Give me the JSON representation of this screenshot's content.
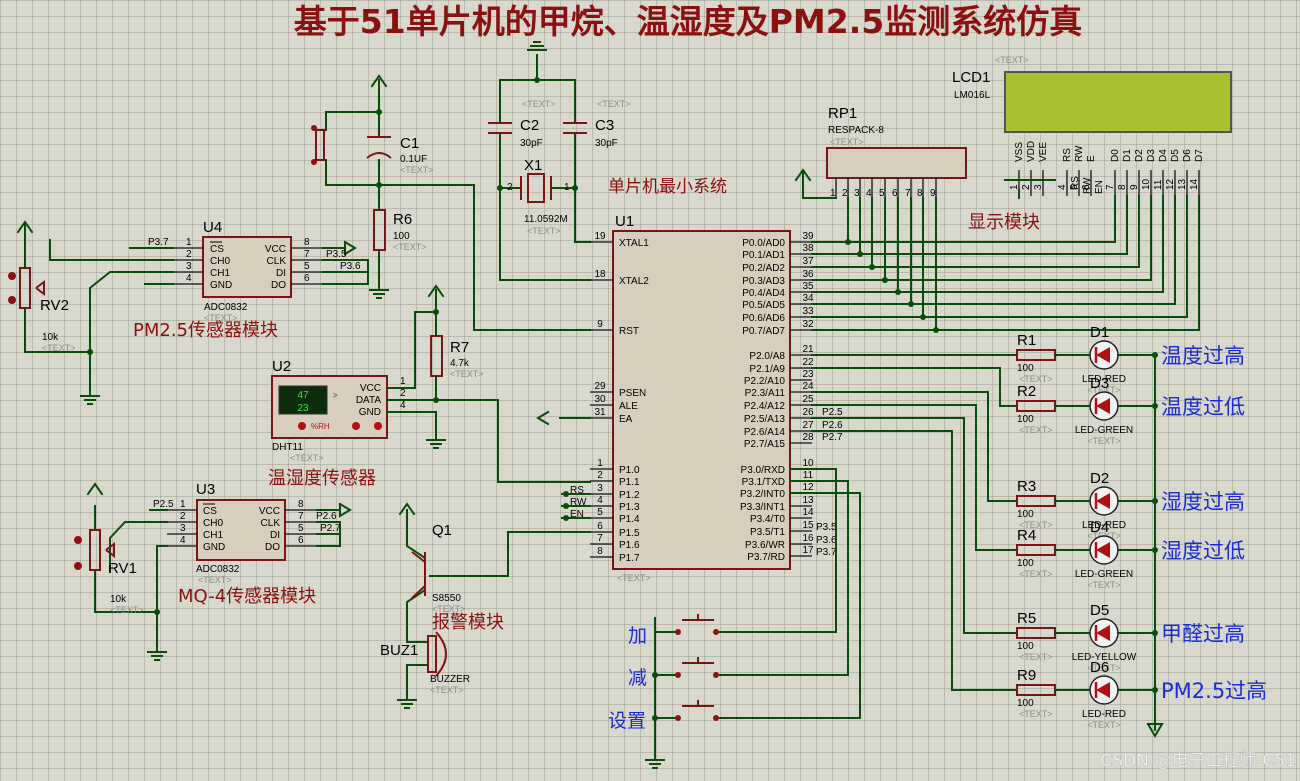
{
  "title": "基于51单片机的甲烷、温湿度及PM2.5监测系统仿真",
  "watermark": "CSDN @电子工程师-C51",
  "text_placeholder": "<TEXT>",
  "modules": {
    "pm25": "PM2.5传感器模块",
    "mq4": "MQ-4传感器模块",
    "dht": "温湿度传感器",
    "alarm": "报警模块",
    "mcu_min": "单片机最小系统",
    "display": "显示模块"
  },
  "components": {
    "C1": {
      "ref": "C1",
      "value": "0.1UF"
    },
    "C2": {
      "ref": "C2",
      "value": "30pF"
    },
    "C3": {
      "ref": "C3",
      "value": "30pF"
    },
    "X1": {
      "ref": "X1",
      "value": "11.0592M"
    },
    "R6": {
      "ref": "R6",
      "value": "100"
    },
    "R7": {
      "ref": "R7",
      "value": "4.7k"
    },
    "RV1": {
      "ref": "RV1",
      "value": "10k"
    },
    "RV2": {
      "ref": "RV2",
      "value": "10k"
    },
    "U1": {
      "ref": "U1"
    },
    "U2": {
      "ref": "U2",
      "value": "DHT11",
      "display_top": "47",
      "display_bottom": "23",
      "rh_label": "%RH"
    },
    "U3": {
      "ref": "U3",
      "value": "ADC0832"
    },
    "U4": {
      "ref": "U4",
      "value": "ADC0832"
    },
    "Q1": {
      "ref": "Q1",
      "value": "S8550"
    },
    "BUZ1": {
      "ref": "BUZ1",
      "value": "BUZZER"
    },
    "RP1": {
      "ref": "RP1",
      "value": "RESPACK-8"
    },
    "LCD1": {
      "ref": "LCD1",
      "value": "LM016L"
    }
  },
  "adc_pins": {
    "left": [
      "CS",
      "CH0",
      "CH1",
      "GND"
    ],
    "left_nums": [
      "1",
      "2",
      "3",
      "4"
    ],
    "right": [
      "VCC",
      "CLK",
      "DI",
      "DO"
    ],
    "right_nums": [
      "8",
      "7",
      "5",
      "6"
    ]
  },
  "u4_nets": {
    "cs": "P3.7",
    "clk": "P3.5",
    "di": "P3.6"
  },
  "u3_nets": {
    "cs": "P2.5",
    "clk": "P2.6",
    "di": "P2.7"
  },
  "dht_pins": {
    "names": [
      "VCC",
      "DATA",
      "GND"
    ],
    "nums": [
      "1",
      "2",
      "4"
    ]
  },
  "mcu_left_pins": [
    {
      "num": "19",
      "name": "XTAL1"
    },
    {
      "num": "18",
      "name": "XTAL2"
    },
    {
      "num": "9",
      "name": "RST"
    },
    {
      "num": "29",
      "name": "PSEN"
    },
    {
      "num": "30",
      "name": "ALE"
    },
    {
      "num": "31",
      "name": "EA"
    },
    {
      "num": "1",
      "name": "P1.0"
    },
    {
      "num": "2",
      "name": "P1.1"
    },
    {
      "num": "3",
      "name": "P1.2"
    },
    {
      "num": "4",
      "name": "P1.3"
    },
    {
      "num": "5",
      "name": "P1.4"
    },
    {
      "num": "6",
      "name": "P1.5"
    },
    {
      "num": "7",
      "name": "P1.6"
    },
    {
      "num": "8",
      "name": "P1.7"
    }
  ],
  "mcu_right_pins": [
    {
      "num": "39",
      "name": "P0.0/AD0"
    },
    {
      "num": "38",
      "name": "P0.1/AD1"
    },
    {
      "num": "37",
      "name": "P0.2/AD2"
    },
    {
      "num": "36",
      "name": "P0.3/AD3"
    },
    {
      "num": "35",
      "name": "P0.4/AD4"
    },
    {
      "num": "34",
      "name": "P0.5/AD5"
    },
    {
      "num": "33",
      "name": "P0.6/AD6"
    },
    {
      "num": "32",
      "name": "P0.7/AD7"
    },
    {
      "num": "21",
      "name": "P2.0/A8"
    },
    {
      "num": "22",
      "name": "P2.1/A9"
    },
    {
      "num": "23",
      "name": "P2.2/A10"
    },
    {
      "num": "24",
      "name": "P2.3/A11"
    },
    {
      "num": "25",
      "name": "P2.4/A12"
    },
    {
      "num": "26",
      "name": "P2.5/A13"
    },
    {
      "num": "27",
      "name": "P2.6/A14"
    },
    {
      "num": "28",
      "name": "P2.7/A15"
    },
    {
      "num": "10",
      "name": "P3.0/RXD"
    },
    {
      "num": "11",
      "name": "P3.1/TXD"
    },
    {
      "num": "12",
      "name": "P3.2/INT0"
    },
    {
      "num": "13",
      "name": "P3.3/INT1"
    },
    {
      "num": "14",
      "name": "P3.4/T0"
    },
    {
      "num": "15",
      "name": "P3.5/T1"
    },
    {
      "num": "16",
      "name": "P3.6/WR"
    },
    {
      "num": "17",
      "name": "P3.7/RD"
    }
  ],
  "mcu_right_nets": {
    "p25": "P2.5",
    "p26": "P2.6",
    "p27": "P2.7",
    "p35": "P3.5",
    "p36": "P3.6",
    "p37": "P3.7"
  },
  "lcd_nets": {
    "rs": "RS",
    "rw": "RW",
    "en": "EN"
  },
  "lcd_pins": [
    {
      "name": "VSS",
      "num": "1"
    },
    {
      "name": "VDD",
      "num": "2"
    },
    {
      "name": "VEE",
      "num": "3"
    },
    {
      "name": "RS",
      "num": "4"
    },
    {
      "name": "RW",
      "num": "5"
    },
    {
      "name": "E",
      "num": "6"
    },
    {
      "name": "D0",
      "num": "7"
    },
    {
      "name": "D1",
      "num": "8"
    },
    {
      "name": "D2",
      "num": "9"
    },
    {
      "name": "D3",
      "num": "10"
    },
    {
      "name": "D4",
      "num": "11"
    },
    {
      "name": "D5",
      "num": "12"
    },
    {
      "name": "D6",
      "num": "13"
    },
    {
      "name": "D7",
      "num": "14"
    }
  ],
  "rp1_pins": [
    "1",
    "2",
    "3",
    "4",
    "5",
    "6",
    "7",
    "8",
    "9"
  ],
  "indicators": [
    {
      "r": "R1",
      "rv": "100",
      "d": "D1",
      "dv": "LED-RED",
      "label": "温度过高"
    },
    {
      "r": "R2",
      "rv": "100",
      "d": "D3",
      "dv": "LED-GREEN",
      "label": "温度过低"
    },
    {
      "r": "R3",
      "rv": "100",
      "d": "D2",
      "dv": "LED-RED",
      "label": "湿度过高"
    },
    {
      "r": "R4",
      "rv": "100",
      "d": "D4",
      "dv": "LED-GREEN",
      "label": "湿度过低"
    },
    {
      "r": "R5",
      "rv": "100",
      "d": "D5",
      "dv": "LED-YELLOW",
      "label": "甲醛过高"
    },
    {
      "r": "R9",
      "rv": "100",
      "d": "D6",
      "dv": "LED-RED",
      "label": "PM2.5过高"
    }
  ],
  "buttons": [
    {
      "label": "加"
    },
    {
      "label": "减"
    },
    {
      "label": "设置"
    }
  ],
  "colors": {
    "wire": "#0a4d0a",
    "part": "#7a1515",
    "chip": "#d9cdbd",
    "lcd_screen": "#a9c033",
    "label_red": "#8b1010",
    "label_blue": "#1a2bd6",
    "led": "#b01010"
  }
}
